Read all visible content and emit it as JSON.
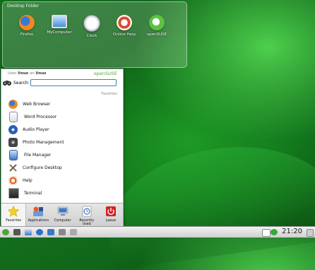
{
  "desktop": {
    "folder_title": "Desktop Folder",
    "icons": [
      {
        "label": "Firefox",
        "icon": "firefox-icon"
      },
      {
        "label": "MyComputer",
        "icon": "computer-icon"
      },
      {
        "label": "Clock",
        "icon": "clock-icon"
      },
      {
        "label": "Online Help",
        "icon": "help-icon"
      },
      {
        "label": "openSUSE",
        "icon": "opensuse-icon"
      }
    ]
  },
  "menu": {
    "user_prefix": "User",
    "user_name": "linus",
    "user_mid": "on",
    "host_name": "linus",
    "brand": "openSUSE",
    "search_label": "Search:",
    "search_value": "",
    "favorites_header": "Favorites",
    "items": [
      {
        "label": "Web Browser",
        "icon": "firefox-icon",
        "color": "#e66a1c"
      },
      {
        "label": "Word Processor",
        "icon": "document-icon",
        "color": "#d8dde8"
      },
      {
        "label": "Audio Player",
        "icon": "audio-icon",
        "color": "#2a5fb6"
      },
      {
        "label": "Photo Management",
        "icon": "camera-icon",
        "color": "#444444"
      },
      {
        "label": "File Manager",
        "icon": "file-manager-icon",
        "color": "#3a78c8"
      },
      {
        "label": "Configure Desktop",
        "icon": "tools-icon",
        "color": "#9a7a4a"
      },
      {
        "label": "Help",
        "icon": "lifebuoy-icon",
        "color": "#e06a2a"
      },
      {
        "label": "Terminal",
        "icon": "terminal-icon",
        "color": "#333333"
      }
    ],
    "tabs": [
      {
        "label": "Favorites",
        "icon": "star-icon"
      },
      {
        "label": "Applications",
        "icon": "applications-icon"
      },
      {
        "label": "Computer",
        "icon": "computer-icon"
      },
      {
        "label": "Recently Used",
        "icon": "recent-icon"
      },
      {
        "label": "Leave",
        "icon": "power-icon"
      }
    ]
  },
  "taskbar": {
    "clock": "21:20"
  }
}
